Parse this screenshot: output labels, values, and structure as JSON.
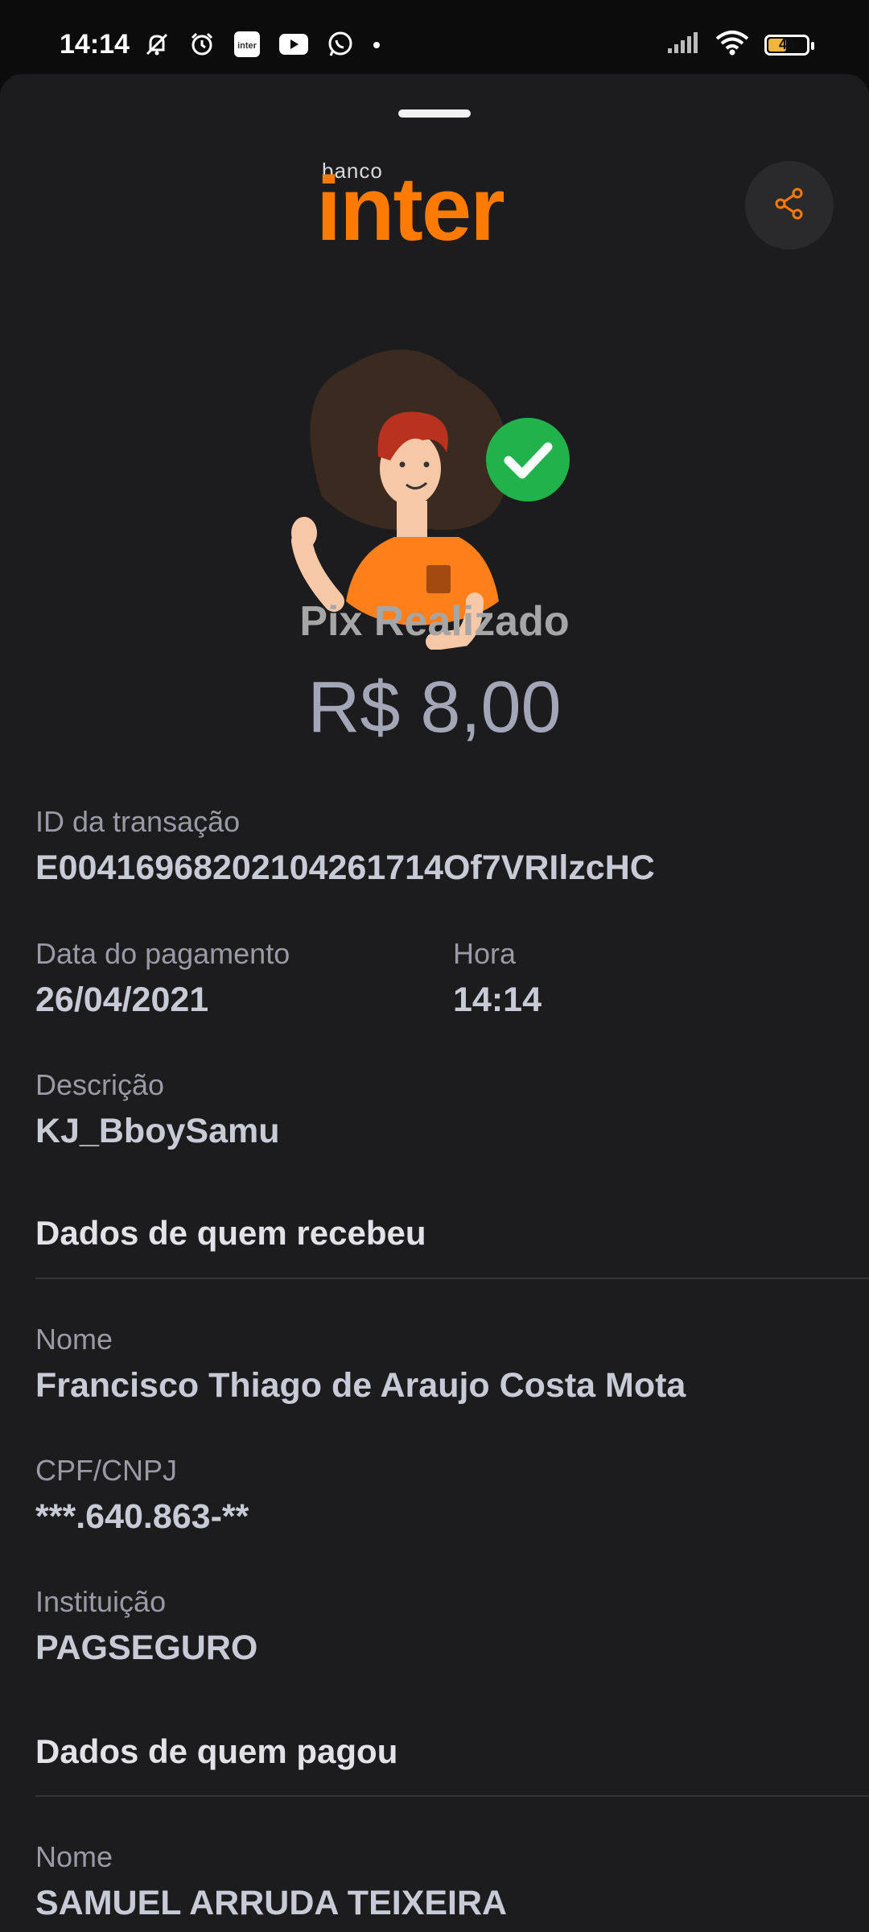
{
  "status_bar": {
    "time": "14:14",
    "battery": "49",
    "icons_left": [
      "mute-icon",
      "alarm-icon",
      "inter-app-icon",
      "youtube-icon",
      "whatsapp-icon",
      "dot-icon"
    ],
    "icons_right": [
      "signal-icon",
      "wifi-icon",
      "battery-icon"
    ]
  },
  "header": {
    "logo_small": "banco",
    "logo_big": "inter",
    "share_icon": "share-icon"
  },
  "receipt": {
    "title": "Pix Realizado",
    "amount": "R$ 8,00"
  },
  "fields": {
    "transaction_id_label": "ID da transação",
    "transaction_id_value": "E00416968202104261714Of7VRIlzcHC",
    "date_label": "Data do pagamento",
    "date_value": "26/04/2021",
    "time_label": "Hora",
    "time_value": "14:14",
    "description_label": "Descrição",
    "description_value": "KJ_BboySamu"
  },
  "receiver": {
    "section_title": "Dados de quem recebeu",
    "name_label": "Nome",
    "name_value": "Francisco Thiago de Araujo Costa Mota",
    "doc_label": "CPF/CNPJ",
    "doc_value": "***.640.863-**",
    "institution_label": "Instituição",
    "institution_value": "PAGSEGURO"
  },
  "payer": {
    "section_title": "Dados de quem pagou",
    "name_label": "Nome",
    "name_value": "SAMUEL ARRUDA TEIXEIRA"
  },
  "colors": {
    "brand_orange": "#ff7a00",
    "success_green": "#22b24c",
    "sheet_bg": "#1c1c1e"
  }
}
